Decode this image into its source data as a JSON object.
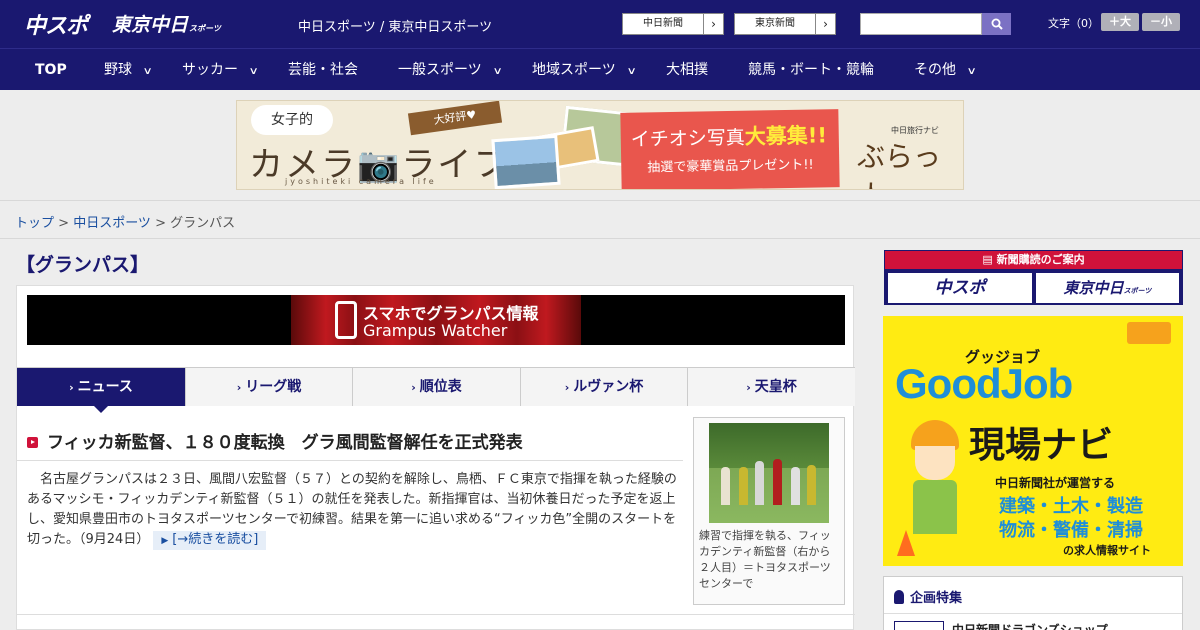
{
  "header": {
    "logo_chuspo": "中スポ",
    "logo_tokyo": "東京中日",
    "logo_tokyo_small": "スポーツ",
    "site_names": "中日スポーツ / 東京中日スポーツ",
    "btn_chunichi": "中日新聞",
    "btn_tokyo": "東京新聞",
    "btn_arrow": "›",
    "search_placeholder": "",
    "fontsize_label": "文字（0）",
    "fontsize_up": "＋大",
    "fontsize_down": "－小"
  },
  "nav": {
    "items": [
      {
        "label": "TOP"
      },
      {
        "label": "野球"
      },
      {
        "label": "サッカー"
      },
      {
        "label": "芸能・社会"
      },
      {
        "label": "一般スポーツ"
      },
      {
        "label": "地域スポーツ"
      },
      {
        "label": "大相撲"
      },
      {
        "label": "競馬・ボート・競輪"
      },
      {
        "label": "その他"
      }
    ]
  },
  "ad": {
    "bubble": "女子的",
    "title": "カメラ📷ライフ",
    "subtitle": "jyoshiteki camera life",
    "ribbon": "大好評♥",
    "line1_prefix": "イチオシ写真",
    "line1_emph": "大募集!!",
    "line2": "抽選で豪華賞品プレゼント!!",
    "brand_small": "中日旅行ナビ",
    "brand": "ぶらっ人"
  },
  "breadcrumb": {
    "top": "トップ",
    "sep": " > ",
    "chunichi": "中日スポーツ",
    "current": "グランパス"
  },
  "section_title": "【グランパス】",
  "grampus_banner": {
    "line1": "スマホでグランパス情報",
    "line2": "Grampus Watcher"
  },
  "tabs": [
    {
      "label": "ニュース"
    },
    {
      "label": "リーグ戦"
    },
    {
      "label": "順位表"
    },
    {
      "label": "ルヴァン杯"
    },
    {
      "label": "天皇杯"
    }
  ],
  "article": {
    "title": "フィッカ新監督、１８０度転換　グラ風間監督解任を正式発表",
    "body": "　名古屋グランパスは２３日、風間八宏監督（５７）との契約を解除し、鳥栖、ＦＣ東京で指揮を執った経験のあるマッシモ・フィッカデンティ新監督（５１）の就任を発表した。新指揮官は、当初休養日だった予定を返上し、愛知県豊田市のトヨタスポーツセンターで初練習。結果を第一に追い求める“フィッカ色”全開のスタートを切った。",
    "date": "（9月24日）",
    "read_more": "[→続きを読む]",
    "caption": "練習で指揮を執る、フィッカデンティ新監督（右から２人目）＝トヨタスポーツセンターで"
  },
  "sidebar": {
    "subscribe_head": "新聞購読のご案内",
    "sub_logo1": "中スポ",
    "sub_logo2": "東京中日",
    "sub_logo2_small": "スポーツ",
    "goodjob_small": "グッジョブ",
    "goodjob_big": "GoodJob",
    "goodjob_navi": "現場ナビ",
    "goodjob_line1": "中日新聞社が運営する",
    "goodjob_line2": "建築・土木・製造",
    "goodjob_line3": "物流・警備・清掃",
    "goodjob_line4": "の求人情報サイト",
    "kikaku_head": "企画特集",
    "kikaku_item": "中日新聞ドラゴンズショップ"
  },
  "colors": {
    "header_bg": "#1a1870",
    "accent_red": "#d0123a",
    "goodjob_yellow": "#ffeb12",
    "goodjob_blue": "#1f8ed8"
  }
}
